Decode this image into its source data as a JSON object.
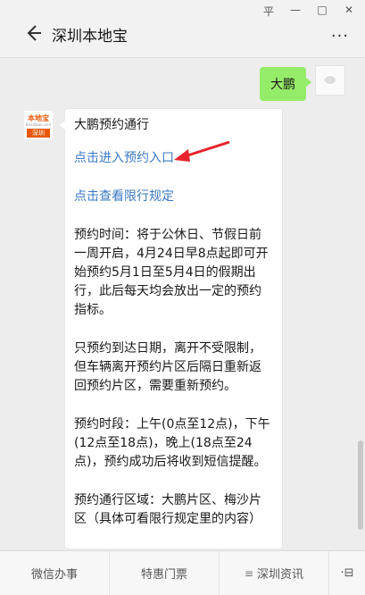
{
  "window": {
    "controls": [
      "平",
      "—",
      "□",
      "✕"
    ]
  },
  "header": {
    "title": "深圳本地宝",
    "more_glyph": "···"
  },
  "chat": {
    "sent_message": "大鹏",
    "official_avatar": {
      "logo_text": "本地宝",
      "logo_sub": "Bendibao.com",
      "logo_city": "深圳"
    },
    "article": {
      "title": "大鹏预约通行",
      "link_enter": "点击进入预约入口",
      "link_rules": "点击查看限行规定",
      "para1": "预约时间：将于公休日、节假日前一周开启，4月24日早8点起即可开始预约5月1日至5月4日的假期出行，此后每天均会放出一定的预约指标。",
      "para2": "只预约到达日期，离开不受限制，但车辆离开预约片区后隔日重新返回预约片区，需要重新预约。",
      "para3": "预约时段：上午(0点至12点)，下午(12点至18点)，晚上(18点至24点)，预约成功后将收到短信提醒。",
      "para4": "预约通行区域：大鹏片区、梅沙片区（具体可看限行规定里的内容）"
    }
  },
  "bottom_menu": {
    "items": [
      "微信办事",
      "特惠门票",
      "深圳资讯"
    ],
    "menu_glyph": "≡",
    "keyboard_glyph": "·⊟"
  },
  "colors": {
    "sent_bubble": "#95ec69",
    "link": "#3a79c4",
    "arrow": "#e8232b",
    "brand": "#e8590c"
  }
}
